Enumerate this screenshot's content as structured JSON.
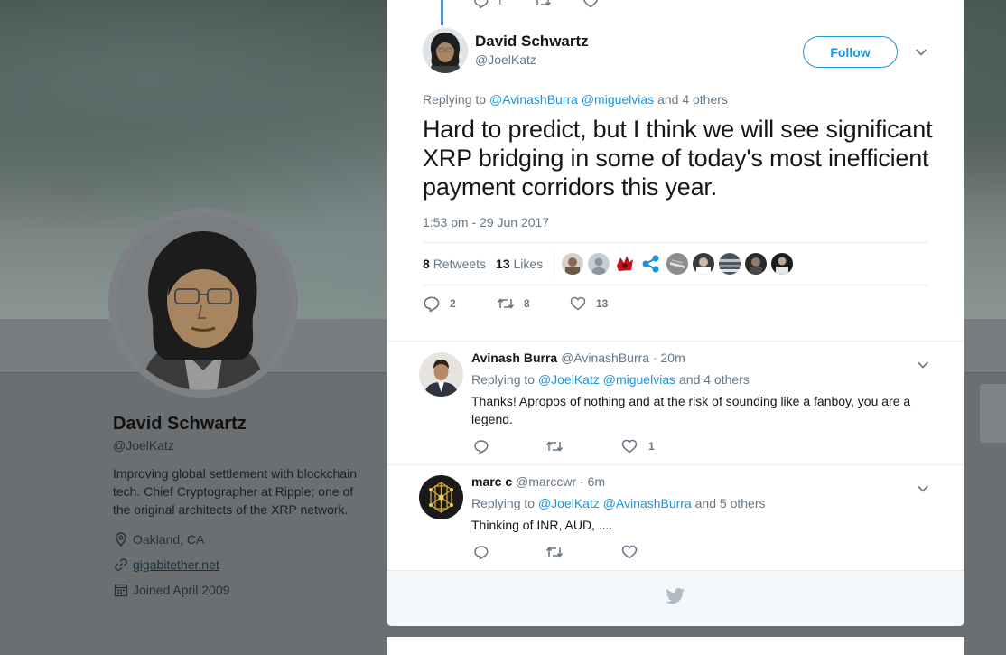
{
  "profile": {
    "name": "David Schwartz",
    "handle": "@JoelKatz",
    "bio": "Improving global settlement with blockchain tech. Chief Cryptographer at Ripple; one of the original architects of the XRP network.",
    "location": "Oakland, CA",
    "website": "gigabitether.net",
    "joined": "Joined April 2009"
  },
  "previous_tweet": {
    "reply_count": "1"
  },
  "tweet": {
    "author_name": "David Schwartz",
    "author_handle": "@JoelKatz",
    "follow_label": "Follow",
    "replying_prefix": "Replying to",
    "mention_1": "@AvinashBurra",
    "mention_2": "@miguelvias",
    "replying_suffix": "and 4 others",
    "text": "Hard to predict, but I think we will see significant XRP bridging in some of today's most inefficient payment corridors this year.",
    "timestamp": "1:53 pm - 29 Jun 2017",
    "retweets_count": "8",
    "retweets_label": "Retweets",
    "likes_count": "13",
    "likes_label": "Likes",
    "reply_count": "2",
    "retweet_count": "8",
    "like_count": "13"
  },
  "replies": [
    {
      "name": "Avinash Burra",
      "handle": "@AvinashBurra",
      "time": "· 20m",
      "replying_prefix": "Replying to",
      "mention_1": "@JoelKatz",
      "mention_2": "@miguelvias",
      "replying_suffix": "and 4 others",
      "text": "Thanks! Apropos of nothing and at the risk of sounding like a fanboy, you are a legend.",
      "like_count": "1"
    },
    {
      "name": "marc c",
      "handle": "@marccwr",
      "time": "· 6m",
      "replying_prefix": "Replying to",
      "mention_1": "@JoelKatz",
      "mention_2": "@AvinashBurra",
      "replying_suffix": "and 5 others",
      "text": "Thinking of INR, AUD, ....",
      "like_count": ""
    }
  ],
  "icons": {
    "location": "location-pin-icon",
    "website": "link-icon",
    "joined": "calendar-icon",
    "reply": "reply-icon",
    "retweet": "retweet-icon",
    "like": "heart-icon",
    "caret": "chevron-down-icon",
    "footer": "twitter-bird-icon"
  },
  "colors": {
    "accent": "#1b95e0",
    "secondary_text": "#657786",
    "thread_line": "#5a8fc6"
  }
}
